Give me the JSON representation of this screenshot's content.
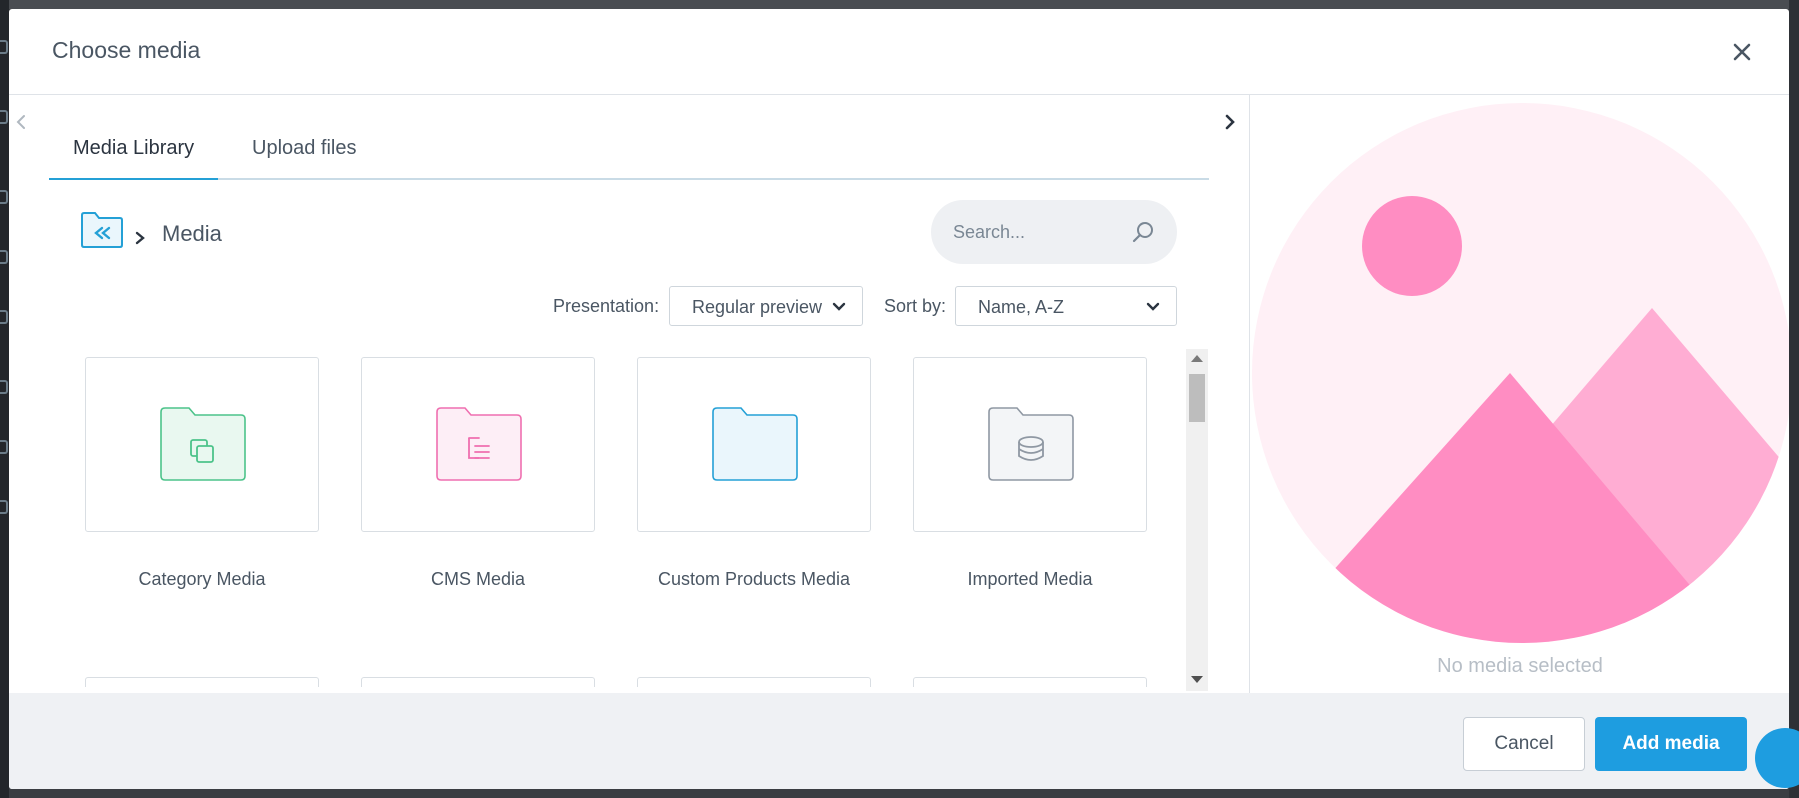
{
  "modal": {
    "title": "Choose media",
    "close_icon": "close-icon"
  },
  "tabs": [
    {
      "label": "Media Library",
      "active": true
    },
    {
      "label": "Upload files",
      "active": false
    }
  ],
  "breadcrumb": {
    "back_icon": "folder-back-icon",
    "current": "Media"
  },
  "search": {
    "placeholder": "Search...",
    "value": ""
  },
  "toolbar": {
    "presentation_label": "Presentation:",
    "presentation_value": "Regular preview",
    "sort_label": "Sort by:",
    "sort_value": "Name, A-Z"
  },
  "folders": [
    {
      "label": "Category Media",
      "icon": "folder-copy-icon",
      "color": "#4cc38a"
    },
    {
      "label": "CMS Media",
      "icon": "folder-document-icon",
      "color": "#ef6fb0"
    },
    {
      "label": "Custom Products Media",
      "icon": "folder-icon",
      "color": "#24a0d6"
    },
    {
      "label": "Imported Media",
      "icon": "folder-database-icon",
      "color": "#8f98a3"
    }
  ],
  "preview": {
    "empty_text": "No media selected",
    "placeholder_icon": "image-placeholder-icon"
  },
  "footer": {
    "cancel_label": "Cancel",
    "add_label": "Add media"
  },
  "colors": {
    "accent": "#1e9de0",
    "placeholder_pink": "#ff8dc2",
    "placeholder_bg": "#fff0f6"
  }
}
